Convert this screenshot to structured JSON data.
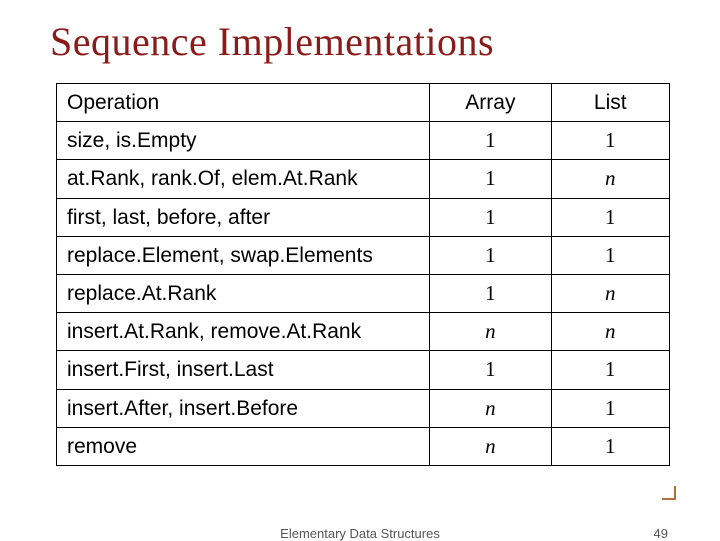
{
  "title": "Sequence Implementations",
  "headers": {
    "operation": "Operation",
    "array": "Array",
    "list": "List"
  },
  "rows": [
    {
      "op": "size, is.Empty",
      "array": "1",
      "list": "1",
      "arrItalic": false,
      "listItalic": false
    },
    {
      "op": "at.Rank, rank.Of, elem.At.Rank",
      "array": "1",
      "list": "n",
      "arrItalic": false,
      "listItalic": true
    },
    {
      "op": "first, last, before, after",
      "array": "1",
      "list": "1",
      "arrItalic": false,
      "listItalic": false
    },
    {
      "op": "replace.Element, swap.Elements",
      "array": "1",
      "list": "1",
      "arrItalic": false,
      "listItalic": false
    },
    {
      "op": "replace.At.Rank",
      "array": "1",
      "list": "n",
      "arrItalic": false,
      "listItalic": true
    },
    {
      "op": "insert.At.Rank, remove.At.Rank",
      "array": "n",
      "list": "n",
      "arrItalic": true,
      "listItalic": true
    },
    {
      "op": "insert.First, insert.Last",
      "array": "1",
      "list": "1",
      "arrItalic": false,
      "listItalic": false
    },
    {
      "op": "insert.After, insert.Before",
      "array": "n",
      "list": "1",
      "arrItalic": true,
      "listItalic": false
    },
    {
      "op": "remove",
      "array": "n",
      "list": "1",
      "arrItalic": true,
      "listItalic": false
    }
  ],
  "footer": {
    "center": "Elementary Data Structures",
    "page": "49"
  }
}
